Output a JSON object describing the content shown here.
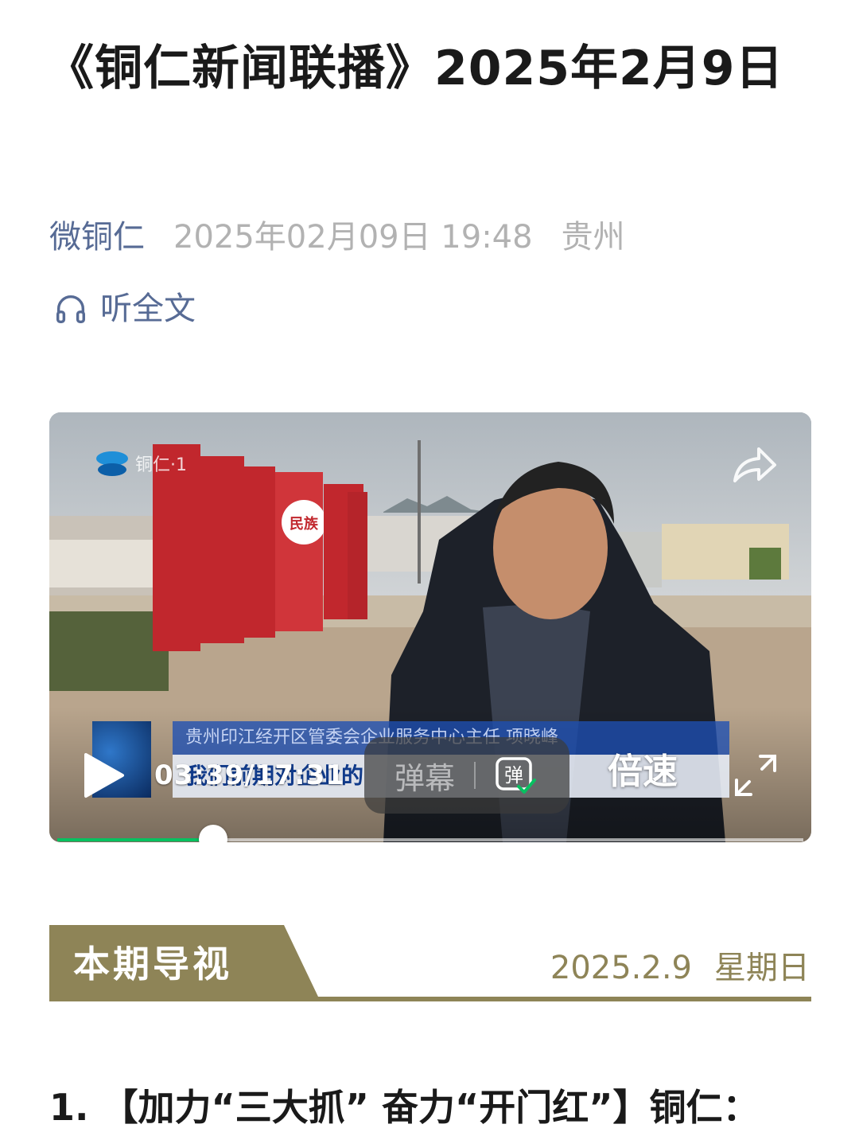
{
  "article": {
    "title": "《铜仁新闻联播》2025年2月9日",
    "account": "微铜仁",
    "datetime": "2025年02月09日 19:48",
    "region": "贵州",
    "listen_label": "听全文"
  },
  "video": {
    "channel_logo_text": "铜仁·1",
    "lower_third_caption": "贵州印江经开区管委会企业服务中心主任 项晓峰",
    "subtitle": "我们前期对企业的",
    "current_time": "03:39",
    "duration": "17:31",
    "time_display": "03:39/17:31",
    "progress_fraction": 0.209,
    "danmu_label": "弹幕",
    "danmu_toggle_glyph": "弹",
    "speed_label": "倍速",
    "icons": [
      "play-icon",
      "share-icon",
      "fullscreen-icon",
      "danmu-toggle-icon"
    ]
  },
  "section": {
    "label": "本期导视",
    "date": "2025.2.9",
    "weekday": "星期日",
    "accent_color": "#8e8457"
  },
  "content": {
    "first_item": "1. 【加力“三大抓” 奋力“开门红”】铜仁："
  }
}
